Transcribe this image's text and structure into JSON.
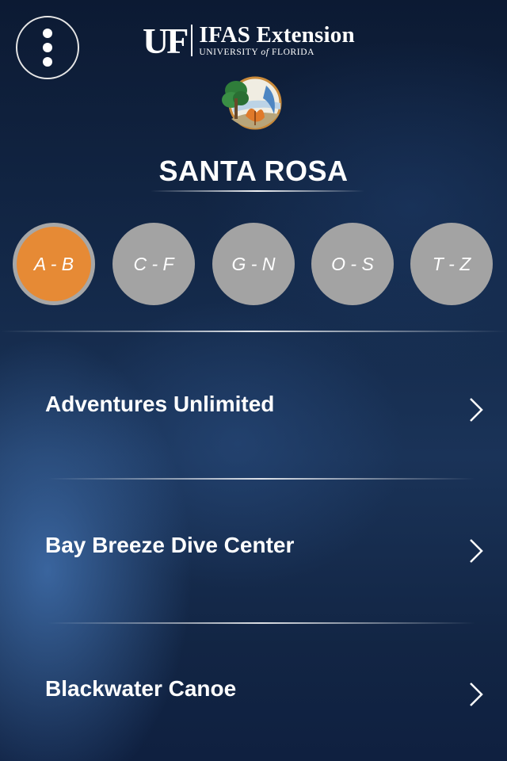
{
  "header": {
    "brand_uf": "UF",
    "brand_ifas": "IFAS Extension",
    "brand_univ_prefix": "UNIVERSITY ",
    "brand_univ_of": "of",
    "brand_univ_suffix": " FLORIDA",
    "menu_icon": "more-vertical-icon",
    "logo_icon": "nature-logo-icon"
  },
  "page": {
    "title": "SANTA ROSA"
  },
  "tabs": [
    {
      "label": "A - B",
      "active": true
    },
    {
      "label": "C - F",
      "active": false
    },
    {
      "label": "G - N",
      "active": false
    },
    {
      "label": "O - S",
      "active": false
    },
    {
      "label": "T - Z",
      "active": false
    }
  ],
  "list": [
    {
      "label": "Adventures Unlimited"
    },
    {
      "label": "Bay Breeze Dive Center"
    },
    {
      "label": "Blackwater Canoe"
    }
  ],
  "colors": {
    "active_tab": "#e68a35",
    "inactive_tab": "#a3a3a3",
    "background": "#132848"
  }
}
